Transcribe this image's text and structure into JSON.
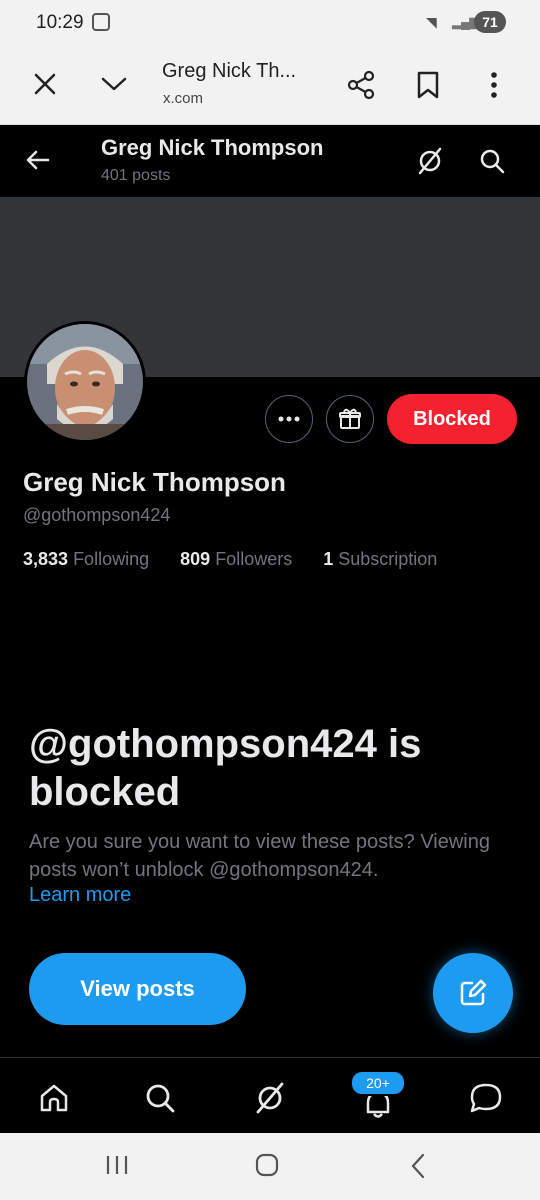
{
  "status_bar": {
    "time": "10:29",
    "battery": "71"
  },
  "browser": {
    "page_title": "Greg Nick Th...",
    "url": "x.com"
  },
  "header": {
    "name": "Greg Nick Thompson",
    "post_count": "401 posts"
  },
  "profile": {
    "name": "Greg Nick Thompson",
    "handle": "@gothompson424",
    "blocked_label": "Blocked",
    "following_count": "3,833",
    "following_label": "Following",
    "followers_count": "809",
    "followers_label": "Followers",
    "subscriptions_count": "1",
    "subscriptions_label": "Subscription"
  },
  "blocked_notice": {
    "title": "@gothompson424 is blocked",
    "body": "Are you sure you want to view these posts? Viewing posts won’t unblock @gothompson424.",
    "learn_more": "Learn more",
    "view_posts": "View posts"
  },
  "bottom_nav": {
    "notifications_badge": "20+"
  },
  "colors": {
    "accent": "#1d9bf0",
    "blocked": "#f4212e",
    "background": "#000000"
  },
  "icons": [
    "close-icon",
    "chevron-down-icon",
    "share-icon",
    "bookmark-icon",
    "more-vert-icon",
    "back-arrow-icon",
    "grok-icon",
    "search-icon",
    "more-horiz-icon",
    "gift-icon",
    "compose-icon",
    "home-icon",
    "bell-icon",
    "messages-icon"
  ]
}
